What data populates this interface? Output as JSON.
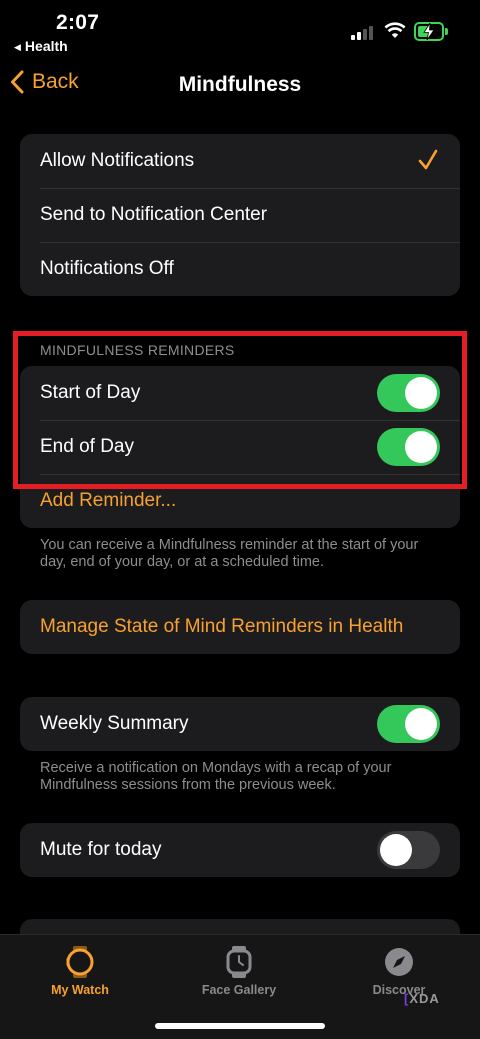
{
  "status_bar": {
    "time": "2:07",
    "back_app": "Health",
    "back_icon": "triangle-left-icon",
    "battery_color": "#3fd35a",
    "battery_charging": true
  },
  "nav": {
    "back_label": "Back",
    "title": "Mindfulness",
    "accent_color": "#f7a12f"
  },
  "notifications": {
    "options": [
      {
        "label": "Allow Notifications",
        "selected": true
      },
      {
        "label": "Send to Notification Center",
        "selected": false
      },
      {
        "label": "Notifications Off",
        "selected": false
      }
    ]
  },
  "reminders": {
    "header": "MINDFULNESS REMINDERS",
    "start_of_day": {
      "label": "Start of Day",
      "on": true
    },
    "end_of_day": {
      "label": "End of Day",
      "on": true
    },
    "add_label": "Add Reminder...",
    "footer": "You can receive a Mindfulness reminder at the start of your day, end of your day, or at a scheduled time."
  },
  "state_of_mind": {
    "link_label": "Manage State of Mind Reminders in Health"
  },
  "weekly_summary": {
    "label": "Weekly Summary",
    "on": true,
    "footer": "Receive a notification on Mondays with a recap of your Mindfulness sessions from the previous week."
  },
  "mute": {
    "label": "Mute for today",
    "on": false
  },
  "tab_bar": {
    "tabs": [
      {
        "label": "My Watch",
        "icon": "watch-icon",
        "active": true
      },
      {
        "label": "Face Gallery",
        "icon": "watch-face-icon",
        "active": false
      },
      {
        "label": "Discover",
        "icon": "compass-icon",
        "active": false
      }
    ]
  },
  "watermark": {
    "text": "XDA",
    "bracket": "["
  },
  "colors": {
    "toggle_on": "#34c759",
    "highlight_box": "#e41e22",
    "background": "#000000",
    "group_background": "#1c1c1e"
  }
}
